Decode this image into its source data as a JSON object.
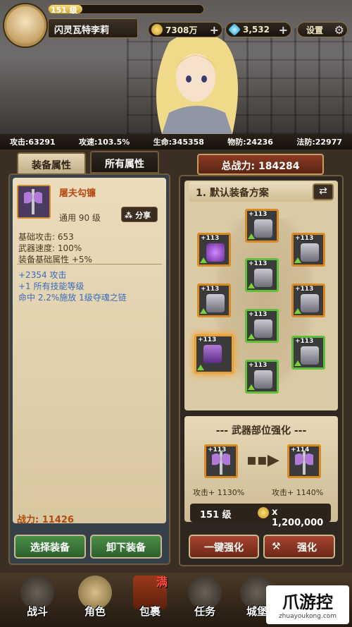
{
  "player": {
    "level": "151 级",
    "name": "闪灵瓦特李莉",
    "level_progress": 0.22
  },
  "resources": {
    "gold": "7308万",
    "gems": "3,532",
    "settings_label": "设置"
  },
  "stats": [
    "攻击:63291",
    "攻速:103.5%",
    "生命:345358",
    "物防:24236",
    "法防:22977"
  ],
  "tabs": {
    "equip_props": "装备属性",
    "all_props": "所有属性"
  },
  "item": {
    "name": "屠夫勾镰",
    "requirement": "通用 90 级",
    "share_label": "分享",
    "base_stats": [
      "基础攻击: 653",
      "武器速度: 100%",
      "装备基础属性 +5%"
    ],
    "bonus_stats": [
      "+2354 攻击",
      "+1 所有技能等级",
      "命中 2.2%施放 1级夺魂之链"
    ],
    "power": "战力: 11426"
  },
  "left_buttons": {
    "select": "选择装备",
    "unequip": "卸下装备"
  },
  "total_power": "总战力: 184284",
  "loadout": {
    "title": "1. 默认装备方案",
    "slot_level": "+113",
    "slots": [
      {
        "name": "helmet-slot",
        "rarity": "orange"
      },
      {
        "name": "necklace-slot",
        "rarity": "orange"
      },
      {
        "name": "armor-slot",
        "rarity": "green"
      },
      {
        "name": "gloves-slot",
        "rarity": "orange"
      },
      {
        "name": "belt-slot",
        "rarity": "orange"
      },
      {
        "name": "bracer-slot",
        "rarity": "orange"
      },
      {
        "name": "legs-slot",
        "rarity": "green"
      },
      {
        "name": "weapon-slot",
        "rarity": "orange"
      },
      {
        "name": "shield-slot",
        "rarity": "green"
      },
      {
        "name": "boots-slot",
        "rarity": "green"
      }
    ]
  },
  "enhance": {
    "title": "--- 武器部位强化 ---",
    "from_level": "+113",
    "to_level": "+114",
    "from_bonus": "攻击+ 1130%",
    "to_bonus": "攻击+ 1140%",
    "cost_level": "151 级",
    "cost_amount": "x 1,200,000",
    "one_click": "一键强化",
    "enhance_btn": "强化"
  },
  "nav": [
    {
      "label": "战斗",
      "icon": "crossed-swords-icon"
    },
    {
      "label": "角色",
      "icon": "helmet-icon"
    },
    {
      "label": "包裹",
      "icon": "bag-icon",
      "badge": "满"
    },
    {
      "label": "任务",
      "icon": "scroll-icon"
    },
    {
      "label": "城堡",
      "icon": "castle-icon"
    }
  ],
  "watermark": {
    "main": "爪游控",
    "sub": "zhuayoukong.com"
  },
  "colors": {
    "accent": "#b44a12",
    "green_btn": "#3f7f3c",
    "red_btn": "#8f3a24"
  }
}
